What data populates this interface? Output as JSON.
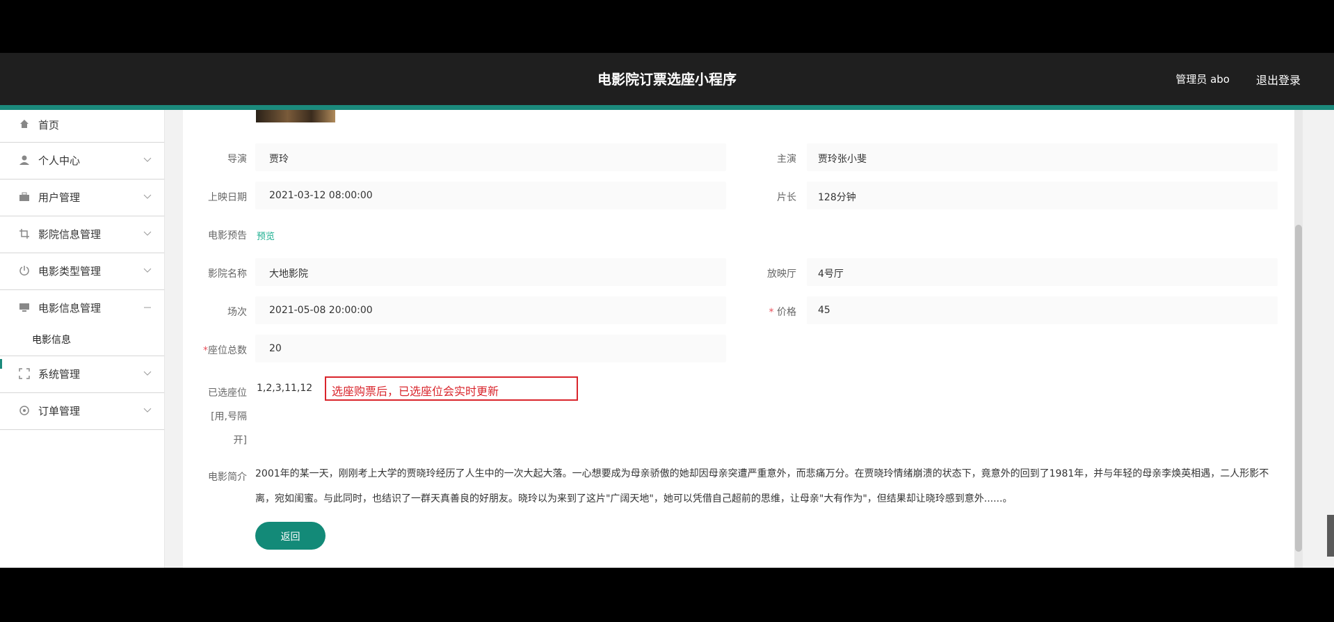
{
  "header": {
    "title": "电影院订票选座小程序",
    "admin_label": "管理员 abo",
    "logout_label": "退出登录"
  },
  "sidebar": {
    "items": [
      {
        "label": "首页",
        "icon": "home-icon"
      },
      {
        "label": "个人中心",
        "icon": "user-icon"
      },
      {
        "label": "用户管理",
        "icon": "briefcase-icon"
      },
      {
        "label": "影院信息管理",
        "icon": "crop-icon"
      },
      {
        "label": "电影类型管理",
        "icon": "power-icon"
      },
      {
        "label": "电影信息管理",
        "icon": "monitor-icon"
      },
      {
        "label": "系统管理",
        "icon": "expand-icon"
      },
      {
        "label": "订单管理",
        "icon": "settings-icon"
      }
    ],
    "sub_item": "电影信息"
  },
  "detail": {
    "director_label": "导演",
    "director": "贾玲",
    "actors_label": "主演",
    "actors": "贾玲张小斐",
    "release_label": "上映日期",
    "release": "2021-03-12 08:00:00",
    "duration_label": "片长",
    "duration": "128分钟",
    "trailer_label": "电影预告",
    "trailer_link": "预览",
    "cinema_label": "影院名称",
    "cinema": "大地影院",
    "hall_label": "放映厅",
    "hall": "4号厅",
    "session_label": "场次",
    "session": "2021-05-08 20:00:00",
    "price_label": "价格",
    "price": "45",
    "seats_label": "座位总数",
    "seats": "20",
    "selected_label_1": "已选座位",
    "selected_label_2": "[用,号隔",
    "selected_label_3": "开]",
    "selected": "1,2,3,11,12",
    "callout": "选座购票后，已选座位会实时更新",
    "intro_label": "电影简介",
    "intro": "2001年的某一天，刚刚考上大学的贾晓玲经历了人生中的一次大起大落。一心想要成为母亲骄傲的她却因母亲突遭严重意外，而悲痛万分。在贾晓玲情绪崩溃的状态下，竟意外的回到了1981年，并与年轻的母亲李焕英相遇，二人形影不离，宛如闺蜜。与此同时，也结识了一群天真善良的好朋友。晓玲以为来到了这片\"广阔天地\"，她可以凭借自己超前的思维，让母亲\"大有作为\"，但结果却让晓玲感到意外......。",
    "back_label": "返回",
    "required_mark": "*"
  },
  "colors": {
    "accent": "#1b8a7c",
    "header_bg": "#1f1f1f",
    "callout_border": "#d9242b",
    "link": "#1aae8f"
  }
}
